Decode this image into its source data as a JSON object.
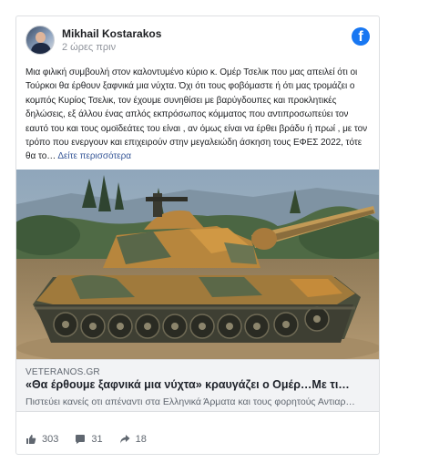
{
  "post": {
    "author": "Mikhail Kostarakos",
    "timestamp": "2 ώρες πριν",
    "text": "Μια φιλική συμβουλή στον καλοντυμένο κύριο κ. Ομέρ Τσελικ που μας απειλεί ότι οι Τούρκοι θα έρθουν ξαφνικά μια νύχτα. Όχι ότι τους φοβόμαστε ή ότι μας τρομάζει ο κομπός Κυρίος Τσελικ, τον έχουμε συνηθίσει με βαρύγδουπες και προκλητικές δηλώσεις, εξ άλλου ένας απλός εκπρόσωπος κόμματος που αντιπροσωπεύει τον εαυτό του και τους ομοϊδεάτες του είναι , αν όμως είναι να έρθει βράδυ ή πρωί , με τον τρόπο που ενεργουν και επιχειρούν στην μεγαλειώδη άσκηση τους ΕΦΕΣ 2022, τότε θα το…",
    "see_more": "Δείτε περισσότερα",
    "brand_icon": "facebook-icon"
  },
  "link_preview": {
    "domain": "VETERANOS.GR",
    "title": "«Θα έρθουμε ξαφνικά μια νύχτα» κραυγάζει ο Ομέρ…Με τι…",
    "description": "Πιστεύει κανείς οτι απέναντι στα Ελληνικά Άρματα και τους φορητούς Αντιαρ…"
  },
  "stats": {
    "likes": "303",
    "comments": "31",
    "shares": "18"
  },
  "colors": {
    "facebook_blue": "#1877f2",
    "link_blue": "#385898",
    "border": "#dddfe2",
    "meta_bg": "#f2f3f5"
  }
}
